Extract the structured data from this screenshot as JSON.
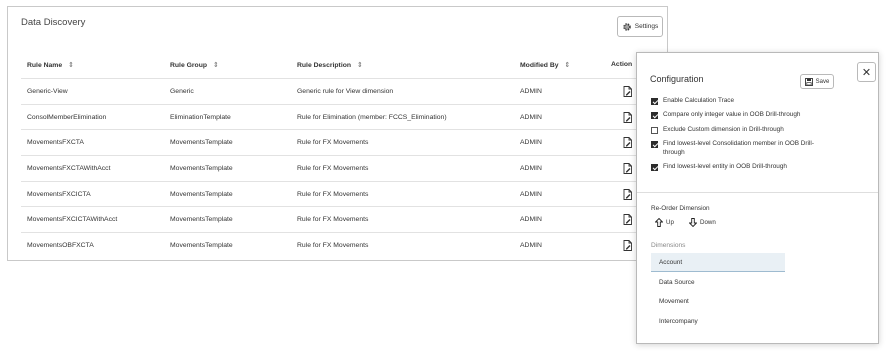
{
  "main": {
    "title": "Data Discovery",
    "settings_label": "Settings",
    "columns": {
      "rule_name": "Rule Name",
      "rule_group": "Rule Group",
      "rule_description": "Rule Description",
      "modified_by": "Modified By",
      "action": "Action"
    },
    "rows": [
      {
        "name": "Generic-View",
        "group": "Generic",
        "description": "Generic rule for View dimension",
        "modified_by": "ADMIN"
      },
      {
        "name": "ConsolMemberElimination",
        "group": "EliminationTemplate",
        "description": "Rule for Elimination (member: FCCS_Elimination)",
        "modified_by": "ADMIN"
      },
      {
        "name": "MovementsFXCTA",
        "group": "MovementsTemplate",
        "description": "Rule for FX Movements",
        "modified_by": "ADMIN"
      },
      {
        "name": "MovementsFXCTAWithAcct",
        "group": "MovementsTemplate",
        "description": "Rule for FX Movements",
        "modified_by": "ADMIN"
      },
      {
        "name": "MovementsFXCICTA",
        "group": "MovementsTemplate",
        "description": "Rule for FX Movements",
        "modified_by": "ADMIN"
      },
      {
        "name": "MovementsFXCICTAWithAcct",
        "group": "MovementsTemplate",
        "description": "Rule for FX Movements",
        "modified_by": "ADMIN"
      },
      {
        "name": "MovementsOBFXCTA",
        "group": "MovementsTemplate",
        "description": "Rule for FX Movements",
        "modified_by": "ADMIN"
      }
    ]
  },
  "config": {
    "title": "Configuration",
    "save_label": "Save",
    "close_glyph": "✕",
    "options": [
      {
        "label": "Enable Calculation Trace",
        "checked": true
      },
      {
        "label": "Compare only integer value in OOB Drill-through",
        "checked": true
      },
      {
        "label": "Exclude Custom dimension in Drill-through",
        "checked": false
      },
      {
        "label": "Find lowest-level Consolidation member in OOB Drill-through",
        "checked": true
      },
      {
        "label": "Find lowest-level entity in OOB Drill-through",
        "checked": true
      }
    ],
    "reorder_label": "Re-Order Dimension",
    "up_label": "Up",
    "down_label": "Down",
    "dimensions_label": "Dimensions",
    "dimensions": [
      {
        "label": "Account",
        "selected": true
      },
      {
        "label": "Data Source",
        "selected": false
      },
      {
        "label": "Movement",
        "selected": false
      },
      {
        "label": "Intercompany",
        "selected": false
      }
    ]
  }
}
